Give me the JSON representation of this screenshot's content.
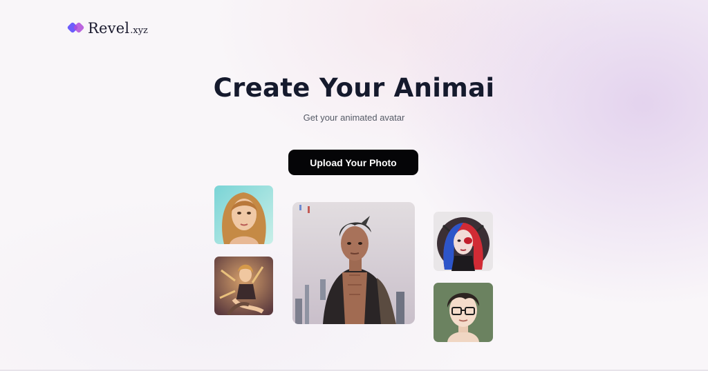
{
  "brand": {
    "name": "Revel",
    "tld": ".xyz",
    "icon": "revel-logo-icon",
    "colors": {
      "primary": "#6d5dfc",
      "secondary": "#b04bd9"
    }
  },
  "hero": {
    "title": "Create Your Animai",
    "subtitle": "Get your animated avatar"
  },
  "cta": {
    "upload_label": "Upload Your Photo",
    "background": "#050507"
  },
  "gallery": {
    "images": [
      {
        "name": "avatar-woman-blonde-portrait"
      },
      {
        "name": "avatar-woman-dancing-golden"
      },
      {
        "name": "avatar-man-jacket-city"
      },
      {
        "name": "avatar-woman-red-blue-hair"
      },
      {
        "name": "avatar-man-glasses"
      }
    ]
  }
}
